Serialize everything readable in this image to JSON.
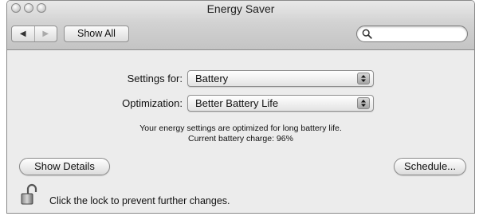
{
  "window": {
    "title": "Energy Saver"
  },
  "toolbar": {
    "back_icon": "back-arrow-icon",
    "forward_icon": "forward-arrow-icon",
    "show_all_label": "Show All",
    "search": {
      "value": "",
      "placeholder": ""
    }
  },
  "settings_for": {
    "label": "Settings for:",
    "selected": "Battery"
  },
  "optimization": {
    "label": "Optimization:",
    "selected": "Better Battery Life"
  },
  "info": {
    "line1": "Your energy settings are optimized for long battery life.",
    "line2": "Current battery charge: 96%"
  },
  "buttons": {
    "show_details": "Show Details",
    "schedule": "Schedule..."
  },
  "lock": {
    "icon": "unlocked-padlock-icon",
    "text": "Click the lock to prevent further changes."
  }
}
